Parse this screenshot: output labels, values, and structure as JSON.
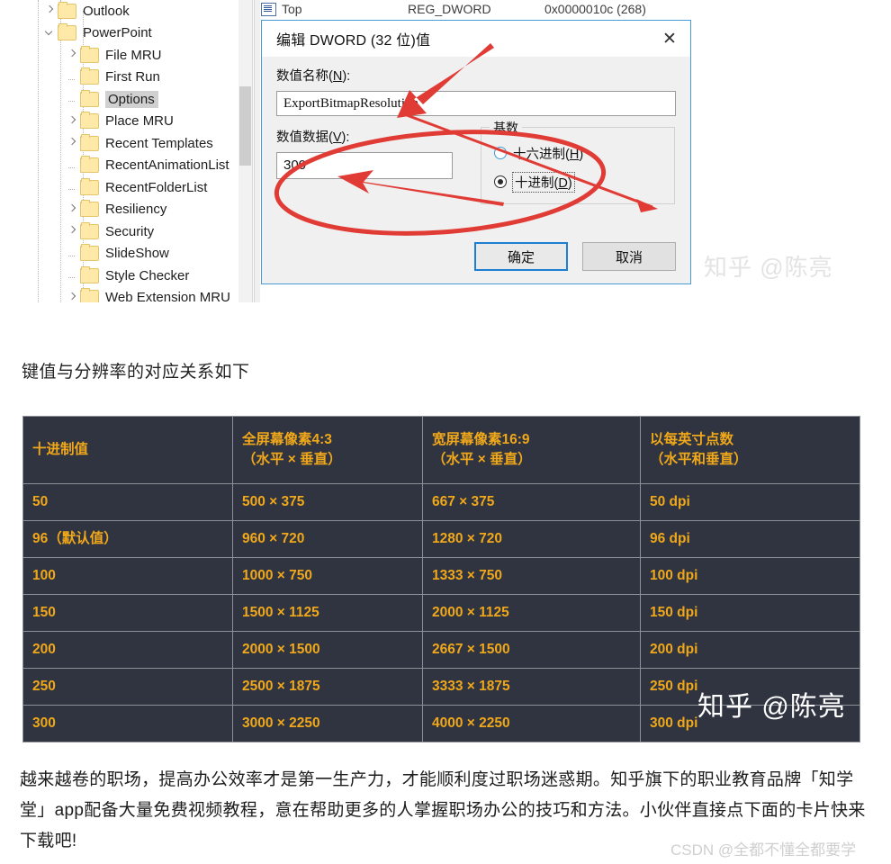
{
  "registry": {
    "tree": {
      "items": [
        {
          "label": "Outlook",
          "indent": 1,
          "marker": "collapsed",
          "selected": false
        },
        {
          "label": "PowerPoint",
          "indent": 1,
          "marker": "expanded",
          "selected": false
        },
        {
          "label": "File MRU",
          "indent": 2,
          "marker": "collapsed",
          "selected": false
        },
        {
          "label": "First Run",
          "indent": 2,
          "marker": "leaf",
          "selected": false
        },
        {
          "label": "Options",
          "indent": 2,
          "marker": "leaf",
          "selected": true
        },
        {
          "label": "Place MRU",
          "indent": 2,
          "marker": "collapsed",
          "selected": false
        },
        {
          "label": "Recent Templates",
          "indent": 2,
          "marker": "collapsed",
          "selected": false
        },
        {
          "label": "RecentAnimationList",
          "indent": 2,
          "marker": "leaf",
          "selected": false
        },
        {
          "label": "RecentFolderList",
          "indent": 2,
          "marker": "leaf",
          "selected": false
        },
        {
          "label": "Resiliency",
          "indent": 2,
          "marker": "collapsed",
          "selected": false
        },
        {
          "label": "Security",
          "indent": 2,
          "marker": "collapsed",
          "selected": false
        },
        {
          "label": "SlideShow",
          "indent": 2,
          "marker": "leaf",
          "selected": false
        },
        {
          "label": "Style Checker",
          "indent": 2,
          "marker": "leaf",
          "selected": false
        },
        {
          "label": "Web Extension MRU",
          "indent": 2,
          "marker": "collapsed",
          "selected": false
        }
      ]
    },
    "value_row": {
      "name": "Top",
      "type": "REG_DWORD",
      "data": "0x0000010c (268)"
    },
    "dialog": {
      "title": "编辑 DWORD (32 位)值",
      "close_glyph": "✕",
      "value_name_label": "数值名称(N):",
      "value_name_label_pre": "数值名称(",
      "value_name_label_key": "N",
      "value_name_label_post": "):",
      "value_name": "ExportBitmapResolution",
      "value_data_label": "数值数据(V):",
      "value_data_label_pre": "数值数据(",
      "value_data_label_key": "V",
      "value_data_label_post": "):",
      "value_data": "300",
      "base_legend": "基数",
      "base_options": [
        {
          "label_pre": "十六进制(",
          "label_key": "H",
          "label_post": ")",
          "selected": false,
          "focused": false
        },
        {
          "label_pre": "十进制(",
          "label_key": "D",
          "label_post": ")",
          "selected": true,
          "focused": true
        }
      ],
      "ok_label": "确定",
      "cancel_label": "取消"
    },
    "watermark": "知乎 @陈亮",
    "accent_colors": {
      "annotation_red": "#e03b34",
      "dialog_border_blue": "#4a9ad4",
      "primary_button_blue": "#1c7fd4",
      "folder_yellow": "#ffe9a8"
    }
  },
  "caption": "键值与分辨率的对应关系如下",
  "table": {
    "headers": [
      {
        "line1": "十进制值",
        "line2": ""
      },
      {
        "line1": "全屏幕像素4:3",
        "line2": "（水平 × 垂直）"
      },
      {
        "line1": "宽屏幕像素16:9",
        "line2": "（水平 × 垂直）"
      },
      {
        "line1": "以每英寸点数",
        "line2": "（水平和垂直）"
      }
    ],
    "rows": [
      [
        "50",
        "500 × 375",
        "667 × 375",
        "50 dpi"
      ],
      [
        "96（默认值）",
        "960 × 720",
        "1280 × 720",
        "96 dpi"
      ],
      [
        "100",
        "1000 × 750",
        "1333 × 750",
        "100 dpi"
      ],
      [
        "150",
        "1500 × 1125",
        "2000 × 1125",
        "150 dpi"
      ],
      [
        "200",
        "2000 × 1500",
        "2667 × 1500",
        "200 dpi"
      ],
      [
        "250",
        "2500 × 1875",
        "3333 × 1875",
        "250 dpi"
      ],
      [
        "300",
        "3000 × 2250",
        "4000 × 2250",
        "300 dpi"
      ]
    ],
    "colors": {
      "background": "#2f3440",
      "text": "#f0a81a",
      "border": "#8c8f96"
    },
    "watermark": "知乎 @陈亮"
  },
  "footer": {
    "paragraph": "越来越卷的职场，提高办公效率才是第一生产力，才能顺利度过职场迷惑期。知乎旗下的职业教育品牌「知学堂」app配备大量免费视频教程，意在帮助更多的人掌握职场办公的技巧和方法。小伙伴直接点下面的卡片快来下载吧!",
    "watermark": "CSDN @全都不懂全都要学"
  }
}
